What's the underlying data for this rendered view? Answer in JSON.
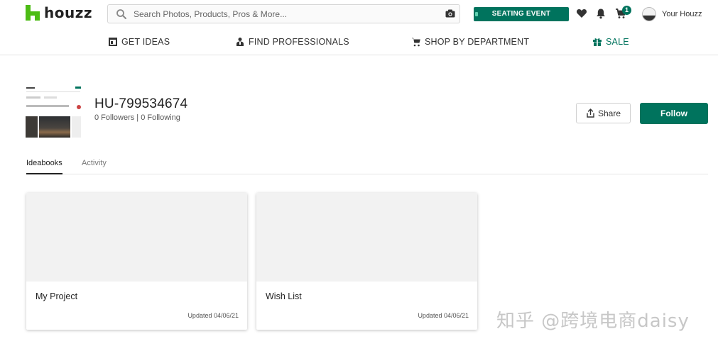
{
  "header": {
    "logo_text": "houzz",
    "search_placeholder": "Search Photos, Products, Pros & More...",
    "seating_event_label": "SEATING EVENT",
    "cart_count": "1",
    "your_houzz_label": "Your Houzz"
  },
  "nav": {
    "items": [
      {
        "label": "GET IDEAS",
        "icon": "ideas-icon"
      },
      {
        "label": "FIND PROFESSIONALS",
        "icon": "professional-icon"
      },
      {
        "label": "SHOP BY DEPARTMENT",
        "icon": "shopping-cart-icon"
      },
      {
        "label": "SALE",
        "icon": "gift-icon"
      }
    ],
    "sale_color": "#00735d"
  },
  "profile": {
    "username": "HU-799534674",
    "follow_counts": "0 Followers | 0 Following",
    "share_label": "Share",
    "follow_label": "Follow"
  },
  "tabs": [
    {
      "label": "Ideabooks",
      "active": true
    },
    {
      "label": "Activity",
      "active": false
    }
  ],
  "ideabooks": [
    {
      "title": "My Project",
      "updated": "Updated 04/06/21"
    },
    {
      "title": "Wish List",
      "updated": "Updated 04/06/21"
    }
  ],
  "watermark": "知乎 @跨境电商daisy",
  "colors": {
    "brand_green": "#4dbc15",
    "accent": "#00735d"
  }
}
